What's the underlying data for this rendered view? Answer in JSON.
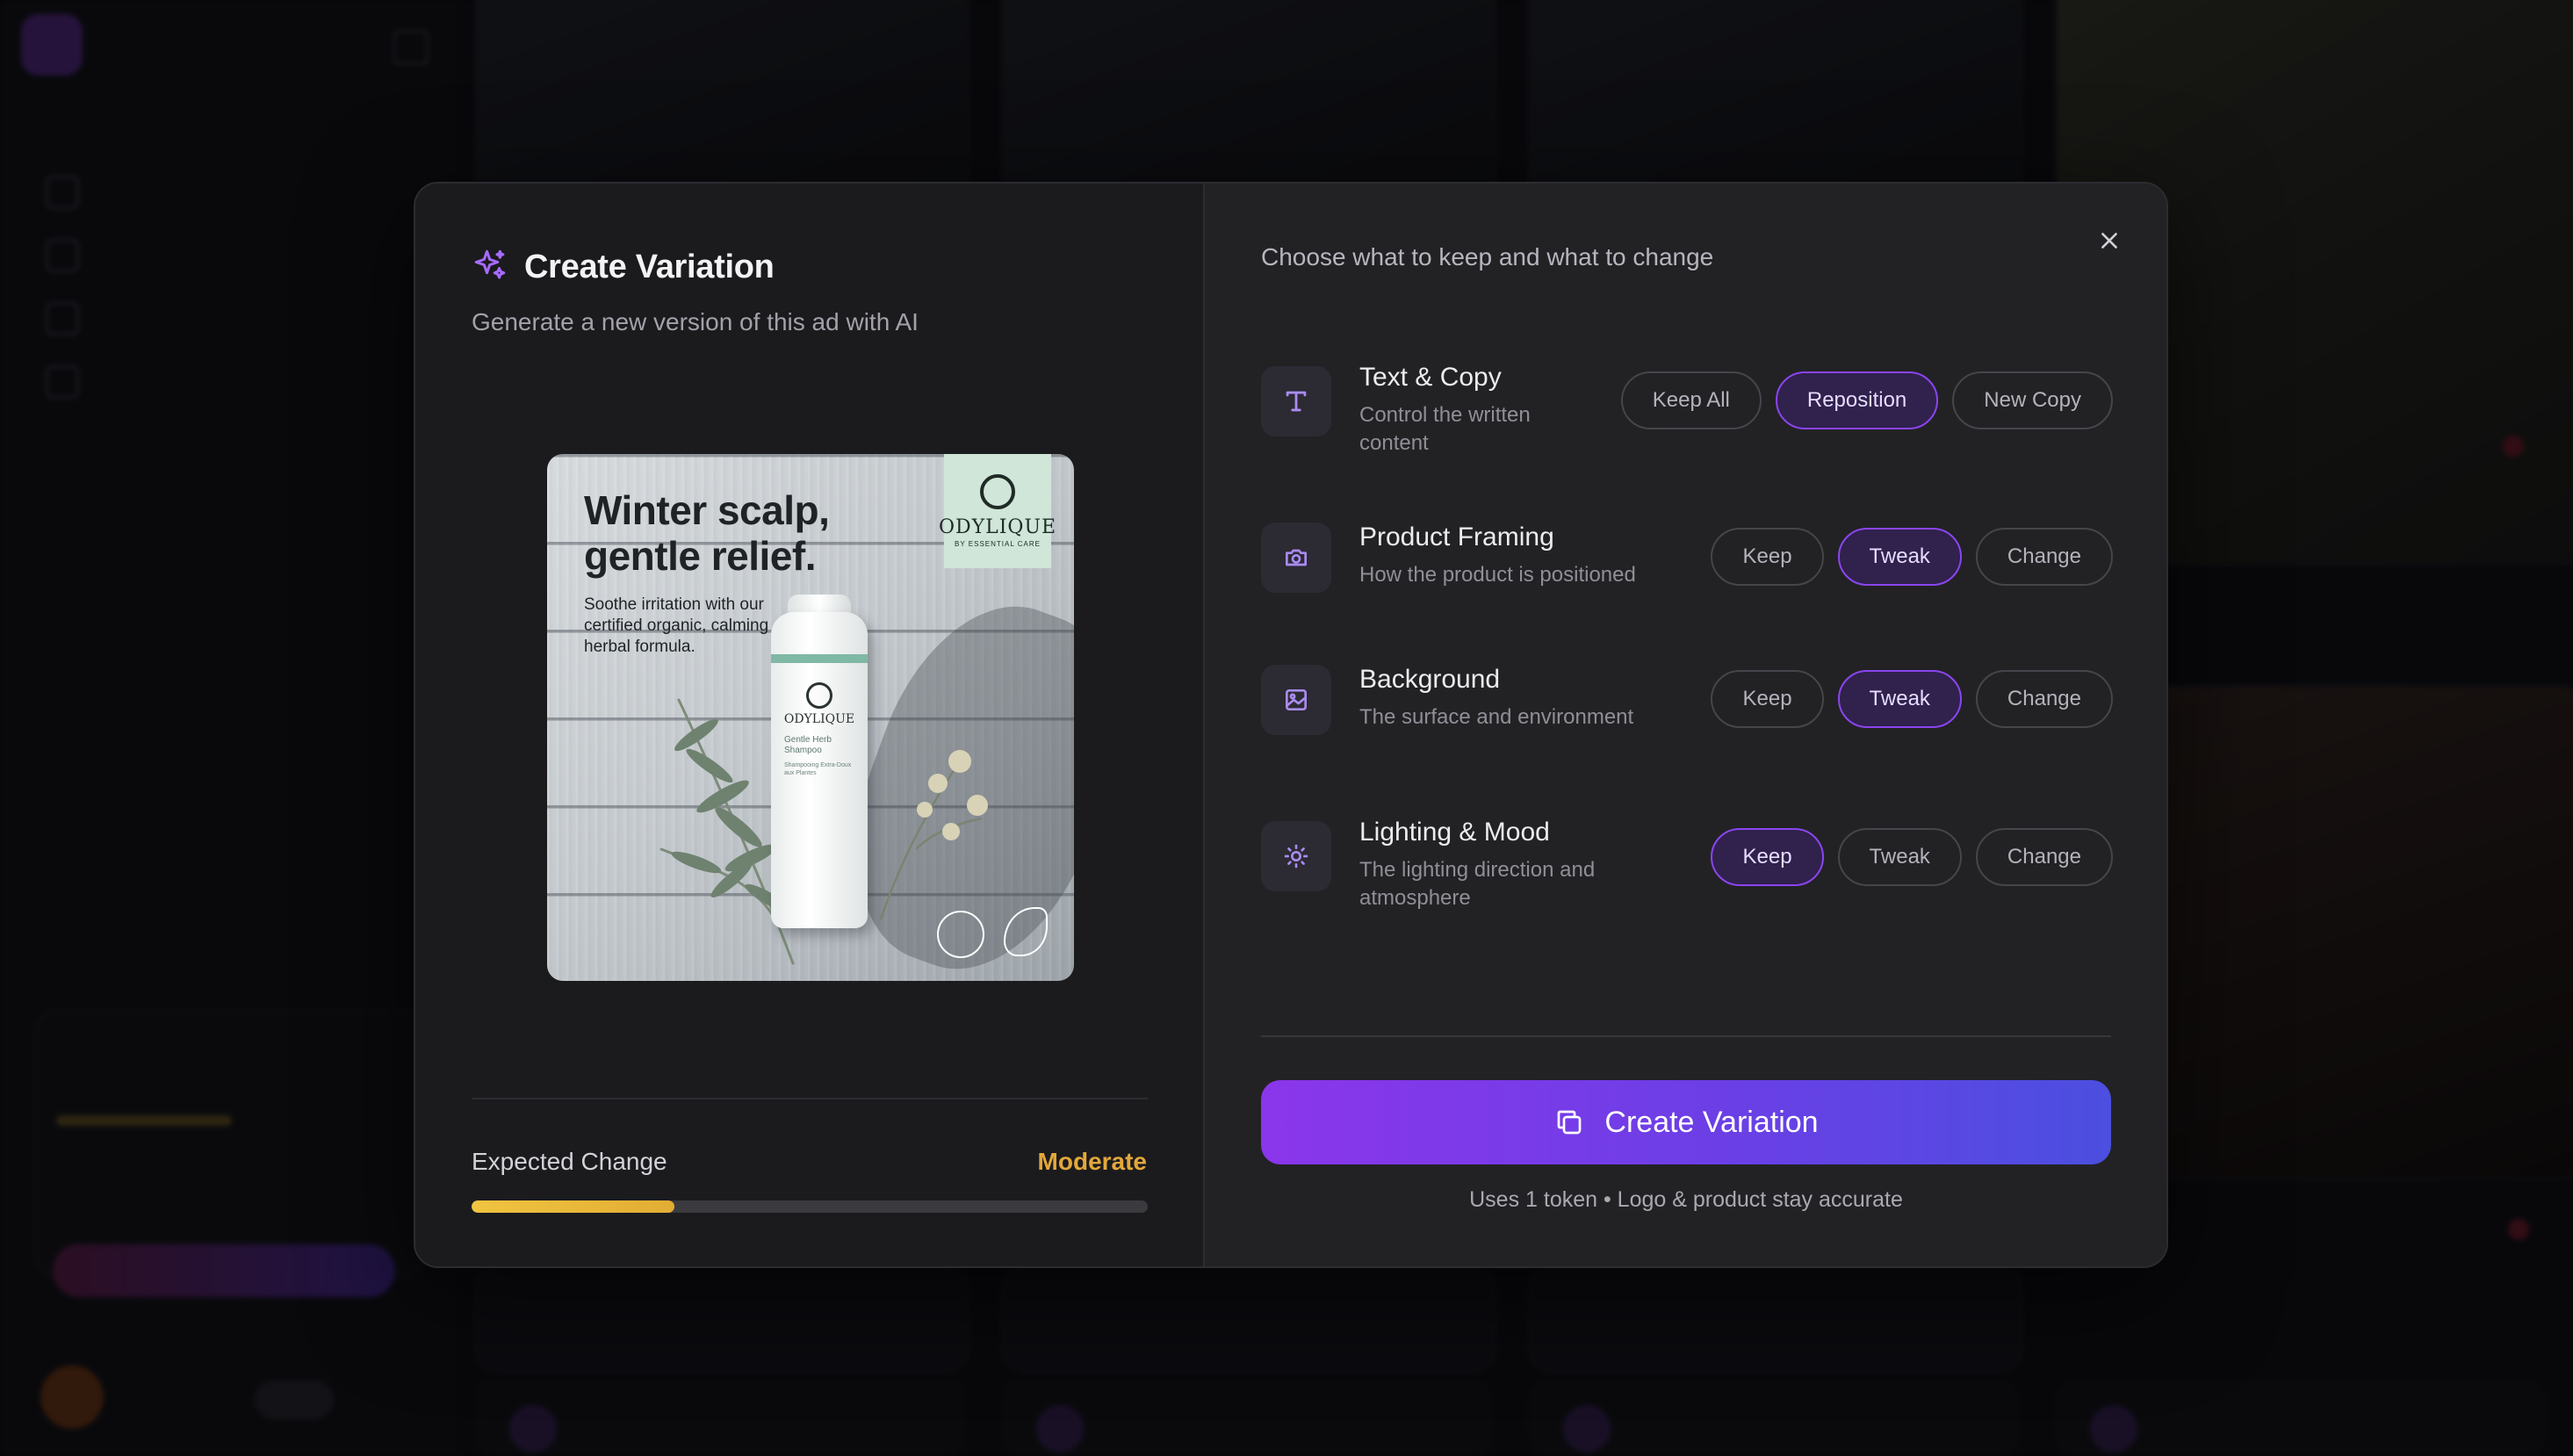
{
  "modal": {
    "title": "Create Variation",
    "subtitle": "Generate a new version of this ad with AI",
    "preview": {
      "headline": "Winter scalp, gentle relief.",
      "body": "Soothe irritation with our certified organic, calming herbal formula.",
      "brand": "ODYLIQUE",
      "brand_tagline": "BY ESSENTIAL CARE",
      "product_name": "Gentle Herb Shampoo",
      "product_subtitle": "Shampooing Extra-Doux aux Plantes"
    },
    "expected_change": {
      "label": "Expected Change",
      "value": "Moderate",
      "level": 0.3,
      "color": "#e3a83a"
    },
    "prompt": "Choose what to keep and what to change",
    "rows": [
      {
        "name": "Text & Copy",
        "desc": "Control the written content",
        "icon": "text-icon",
        "options": [
          "Keep All",
          "Reposition",
          "New Copy"
        ],
        "selected": "Reposition"
      },
      {
        "name": "Product Framing",
        "desc": "How the product is positioned",
        "icon": "camera-icon",
        "options": [
          "Keep",
          "Tweak",
          "Change"
        ],
        "selected": "Tweak"
      },
      {
        "name": "Background",
        "desc": "The surface and environment",
        "icon": "image-icon",
        "options": [
          "Keep",
          "Tweak",
          "Change"
        ],
        "selected": "Tweak"
      },
      {
        "name": "Lighting & Mood",
        "desc": "The lighting direction and atmosphere",
        "icon": "sun-icon",
        "options": [
          "Keep",
          "Tweak",
          "Change"
        ],
        "selected": "Keep"
      }
    ],
    "cta_label": "Create Variation",
    "footnote": "Uses 1 token • Logo & product stay accurate"
  },
  "colors": {
    "accent": "#8b45f0",
    "accent_bg": "#30214d",
    "warning": "#e3a83a"
  }
}
